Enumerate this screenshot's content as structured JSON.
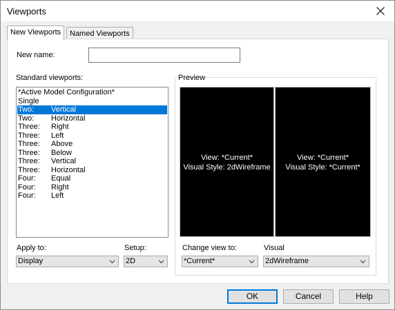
{
  "window": {
    "title": "Viewports"
  },
  "tabs": [
    {
      "label": "New Viewports",
      "active": true
    },
    {
      "label": "Named Viewports",
      "active": false
    }
  ],
  "new_name": {
    "label": "New name:",
    "value": ""
  },
  "standard_viewports": {
    "label": "Standard viewports:",
    "items": [
      {
        "c1": "*Active Model Configuration*",
        "c2": ""
      },
      {
        "c1": "Single",
        "c2": ""
      },
      {
        "c1": "Two:",
        "c2": "Vertical"
      },
      {
        "c1": "Two:",
        "c2": "Horizontal"
      },
      {
        "c1": "Three:",
        "c2": "Right"
      },
      {
        "c1": "Three:",
        "c2": "Left"
      },
      {
        "c1": "Three:",
        "c2": "Above"
      },
      {
        "c1": "Three:",
        "c2": "Below"
      },
      {
        "c1": "Three:",
        "c2": "Vertical"
      },
      {
        "c1": "Three:",
        "c2": "Horizontal"
      },
      {
        "c1": "Four:",
        "c2": "Equal"
      },
      {
        "c1": "Four:",
        "c2": "Right"
      },
      {
        "c1": "Four:",
        "c2": "Left"
      }
    ],
    "selected_index": 2
  },
  "preview": {
    "label": "Preview",
    "left": {
      "line1": "View: *Current*",
      "line2": "Visual Style: 2dWireframe"
    },
    "right": {
      "line1": "View: *Current*",
      "line2": "Visual Style: *Current*"
    }
  },
  "apply_to": {
    "label": "Apply to:",
    "value": "Display"
  },
  "setup": {
    "label": "Setup:",
    "value": "2D"
  },
  "change_view": {
    "label": "Change view to:",
    "value": "*Current*"
  },
  "visual": {
    "label": "Visual",
    "value": "2dWireframe"
  },
  "buttons": {
    "ok": "OK",
    "cancel": "Cancel",
    "help": "Help"
  },
  "colors": {
    "selection": "#0078d7",
    "preview_bg": "#000000",
    "default_button_border": "#0078d7"
  },
  "icons": {
    "close": "close-icon",
    "dropdown": "chevron-down-icon"
  }
}
